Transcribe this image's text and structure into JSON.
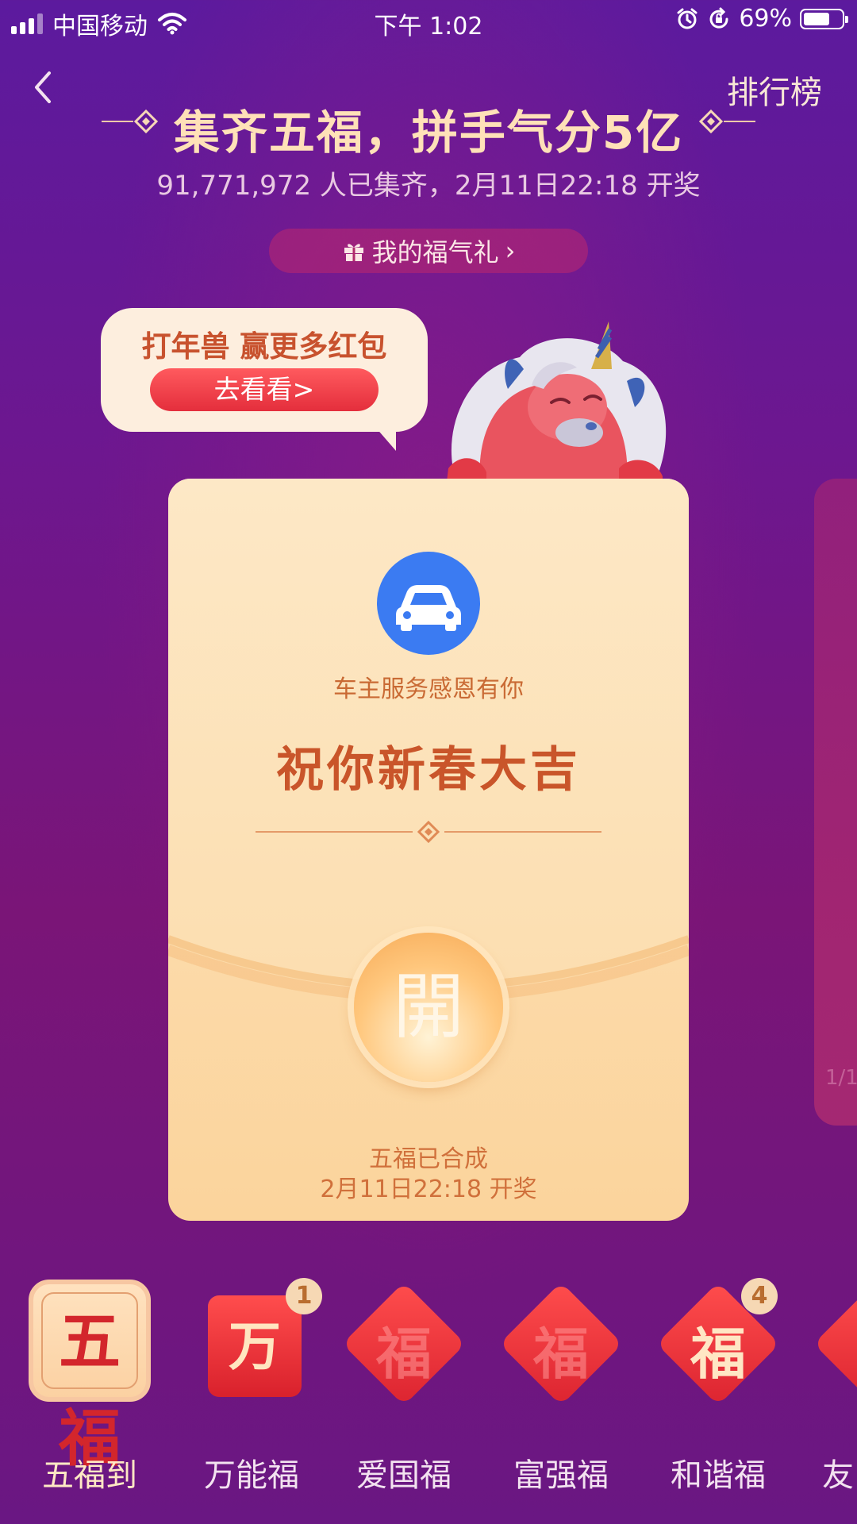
{
  "status_bar": {
    "carrier": "中国移动",
    "time": "下午 1:02",
    "battery_percent": "69%",
    "battery_level": 0.69,
    "icons": [
      "signal-icon",
      "wifi-icon",
      "alarm-icon",
      "rotation-lock-icon",
      "battery-icon"
    ]
  },
  "header": {
    "back_icon": "chevron-left-icon",
    "ranking_label": "排行榜",
    "title": "集齐五福，拼手气分5亿",
    "subtitle": "91,771,972 人已集齐，2月11日22:18 开奖",
    "gift_label": "我的福气礼",
    "gift_icon": "gift-icon",
    "gift_chevron": "›"
  },
  "promo": {
    "title": "打年兽 赢更多红包",
    "button_label": "去看看>"
  },
  "card": {
    "sponsor_icon": "car-icon",
    "sponsor_text": "车主服务感恩有你",
    "blessing": "祝你新春大吉",
    "open_label": "開",
    "status_line1": "五福已合成",
    "status_line2": "2月11日22:18 开奖"
  },
  "side_card": {
    "page_indicator": "1/1"
  },
  "fu_cards": [
    {
      "label": "五福到",
      "glyph": "五福",
      "selected": true,
      "count": ""
    },
    {
      "label": "万能福",
      "glyph": "万",
      "selected": false,
      "count": "1"
    },
    {
      "label": "爱国福",
      "glyph": "福",
      "selected": false,
      "count": ""
    },
    {
      "label": "富强福",
      "glyph": "福",
      "selected": false,
      "count": ""
    },
    {
      "label": "和谐福",
      "glyph": "福",
      "selected": false,
      "count": "4"
    },
    {
      "label": "友",
      "glyph": "",
      "selected": false,
      "count": ""
    }
  ],
  "colors": {
    "background_top": "#5c1a9e",
    "background_bottom": "#6a1783",
    "title_gold": "#ffe1b8",
    "card_cream": "#fde6c2",
    "accent_red": "#e42e3c",
    "brand_blue": "#3b7bf2"
  }
}
